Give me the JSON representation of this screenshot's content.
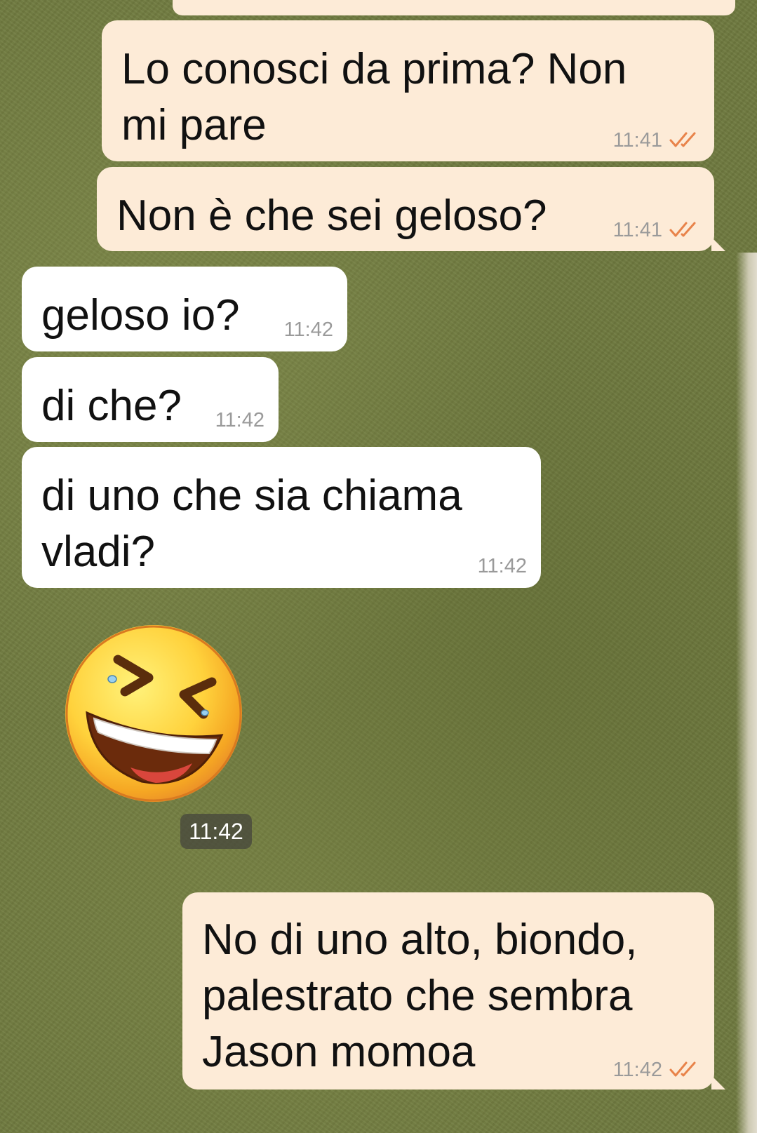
{
  "messages": [
    {
      "text": "Lo conosci da prima? Non\nmi pare",
      "time": "11:41"
    },
    {
      "text": "Non è che sei geloso?",
      "time": "11:41"
    },
    {
      "text": "geloso io?",
      "time": "11:42"
    },
    {
      "text": "di che?",
      "time": "11:42"
    },
    {
      "text": "di uno che sia chiama\nvladi?",
      "time": "11:42"
    },
    {
      "emoji": "grinning-squinting-face",
      "time": "11:42"
    },
    {
      "text": "No di uno alto, biondo,\npalestrato che sembra\nJason momoa",
      "time": "11:42"
    }
  ],
  "colors": {
    "outgoing_bubble": "#fdebd7",
    "incoming_bubble": "#ffffff",
    "read_check": "#e8834a",
    "wallpaper": "#6f7a3f"
  }
}
